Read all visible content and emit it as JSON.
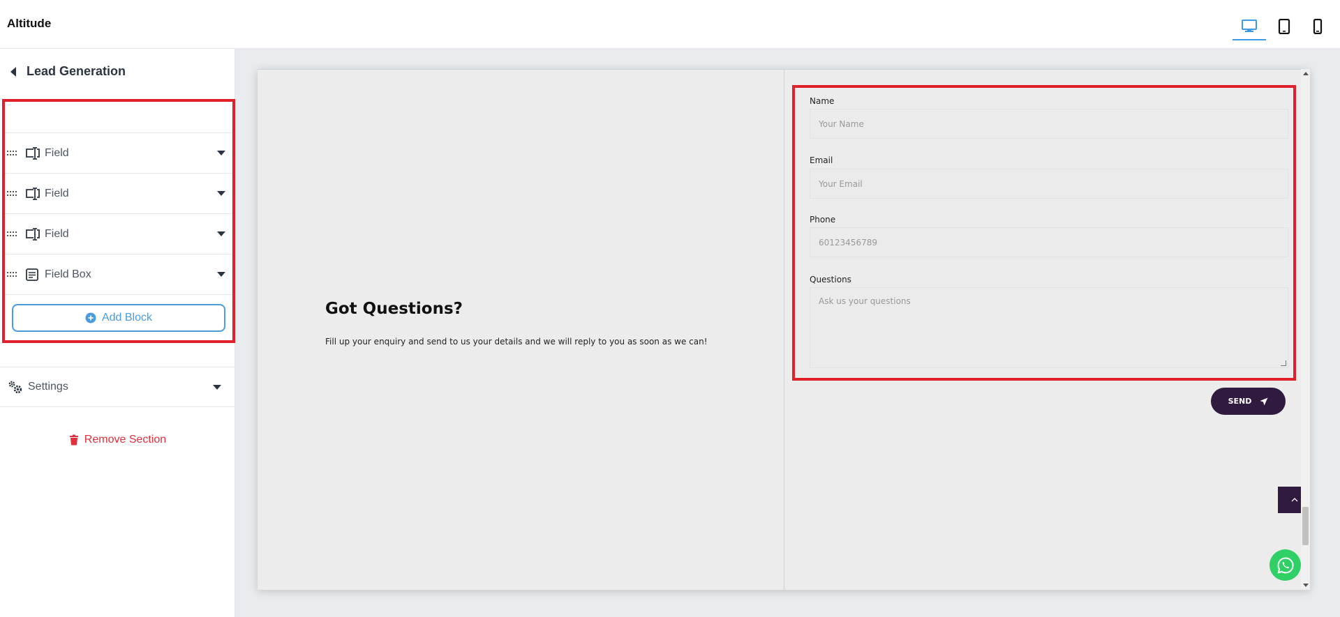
{
  "app": {
    "title": "Altitude"
  },
  "toolbar": {
    "devices": [
      {
        "icon": "desktop-icon",
        "active": true
      },
      {
        "icon": "tablet-icon",
        "active": false
      },
      {
        "icon": "mobile-icon",
        "active": false
      }
    ]
  },
  "sidebar": {
    "section_title": "Lead Generation",
    "blocks": [
      {
        "label": "Field",
        "icon": "input-field-icon"
      },
      {
        "label": "Field",
        "icon": "input-field-icon"
      },
      {
        "label": "Field",
        "icon": "input-field-icon"
      },
      {
        "label": "Field Box",
        "icon": "textarea-icon"
      }
    ],
    "add_block_label": "Add Block",
    "settings_label": "Settings",
    "remove_label": "Remove Section"
  },
  "preview": {
    "heading": "Got Questions?",
    "subtext": "Fill up your enquiry and send to us your details and we will reply to you as soon as we can!",
    "form": {
      "name": {
        "label": "Name",
        "placeholder": "Your Name"
      },
      "email": {
        "label": "Email",
        "placeholder": "Your Email"
      },
      "phone": {
        "label": "Phone",
        "placeholder": "60123456789"
      },
      "questions": {
        "label": "Questions",
        "placeholder": "Ask us your questions"
      }
    },
    "send_label": "SEND"
  },
  "colors": {
    "accent": "#4a9be0",
    "highlight": "#e0202a",
    "button_dark": "#311a40",
    "whatsapp": "#2fd065",
    "danger": "#e0303a"
  }
}
